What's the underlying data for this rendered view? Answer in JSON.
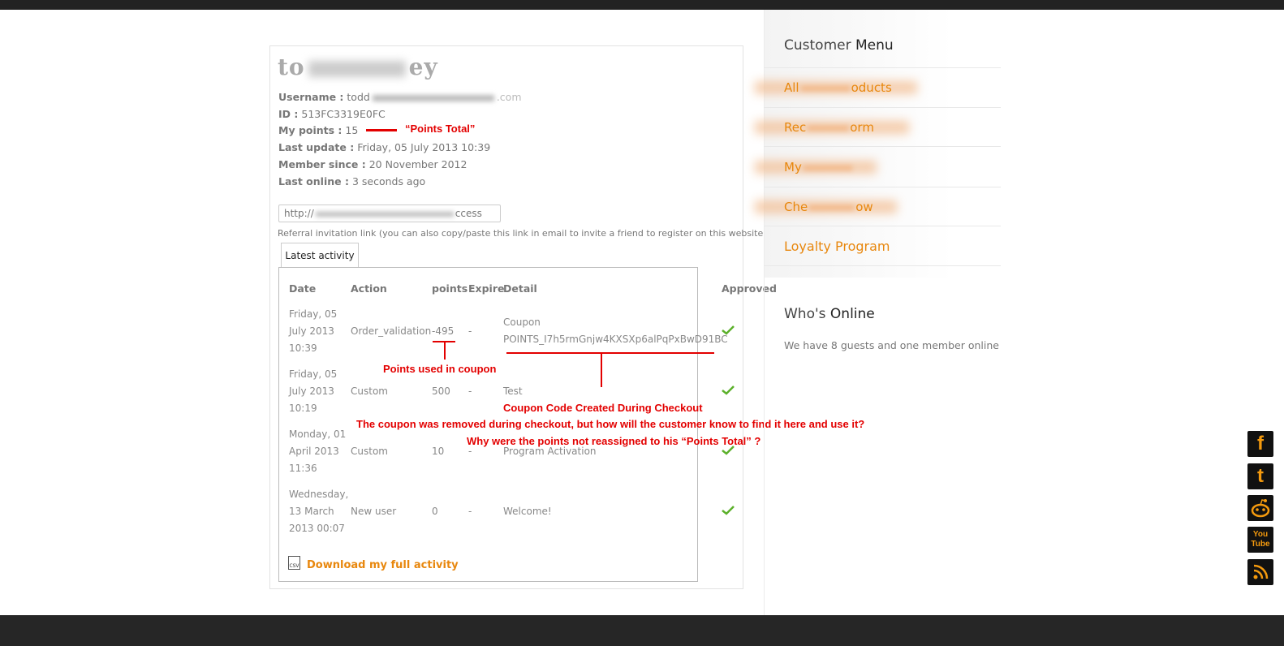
{
  "profile": {
    "name_visible": "to",
    "name_tail": "ey",
    "username_label": "Username :",
    "username_visible": "todd",
    "username_tail": ".com",
    "id_label": "ID :",
    "id_value": "513FC3319E0FC",
    "points_label": "My points :",
    "points_value": "15",
    "last_update_label": "Last update :",
    "last_update_value": "Friday, 05 July 2013 10:39",
    "member_since_label": "Member since :",
    "member_since_value": "20 November 2012",
    "last_online_label": "Last online :",
    "last_online_value": "3 seconds ago"
  },
  "referral": {
    "link_visible": "http://",
    "link_tail": "ccess",
    "hint": "Referral invitation link (you can also copy/paste this link in email to invite a friend to register on this website)."
  },
  "activity": {
    "tab_label": "Latest activity",
    "headers": {
      "date": "Date",
      "action": "Action",
      "points": "points",
      "expire": "Expire",
      "detail": "Detail",
      "approved": "Approved"
    },
    "rows": [
      {
        "date1": "Friday, 05",
        "date2": "July 2013",
        "date3": "10:39",
        "action": "Order_validation",
        "points": "-495",
        "expire": "-",
        "detail1": "Coupon",
        "detail2": "POINTS_I7h5rmGnjw4KXSXp6alPqPxBwD91BC"
      },
      {
        "date1": "Friday, 05",
        "date2": "July 2013",
        "date3": "10:19",
        "action": "Custom",
        "points": "500",
        "expire": "-",
        "detail1": "Test",
        "detail2": ""
      },
      {
        "date1": "Monday, 01",
        "date2": "April 2013",
        "date3": "11:36",
        "action": "Custom",
        "points": "10",
        "expire": "-",
        "detail1": "Program Activation",
        "detail2": ""
      },
      {
        "date1": "Wednesday,",
        "date2": "13 March",
        "date3": "2013 00:07",
        "action": "New user",
        "points": "0",
        "expire": "-",
        "detail1": "Welcome!",
        "detail2": ""
      }
    ],
    "download_label": "Download my full activity",
    "csv_icon_label": "CSV"
  },
  "annotations": {
    "points_total": "“Points Total”",
    "points_used": "Points used in coupon",
    "coupon_created": "Coupon Code Created During Checkout",
    "question1": "The coupon was removed during checkout, but how will the customer know to find it here and use it?",
    "question2": "Why were the points not reassigned to his “Points Total” ?"
  },
  "sidebar": {
    "menu_heading_plain": "Customer",
    "menu_heading_bold": "Menu",
    "items": [
      {
        "label_visible": "All",
        "label_tail": "oducts"
      },
      {
        "label_visible": "Rec",
        "label_tail": "orm"
      },
      {
        "label_visible": "My",
        "label_tail": ""
      },
      {
        "label_visible": "Che",
        "label_tail": "ow"
      },
      {
        "label_visible": "Loyalty Program",
        "label_tail": ""
      }
    ],
    "online_heading_plain": "Who's",
    "online_heading_bold": "Online",
    "online_text": "We have 8 guests and one member online"
  },
  "social": [
    "facebook-icon",
    "twitter-icon",
    "reddit-icon",
    "youtube-icon",
    "rss-icon"
  ],
  "social_labels": {
    "facebook": "f",
    "twitter": "t",
    "youtube_top": "You",
    "youtube_bottom": "Tube"
  },
  "colors": {
    "accent": "#e8870d",
    "annotation": "#e30000",
    "bars": "#222222"
  }
}
